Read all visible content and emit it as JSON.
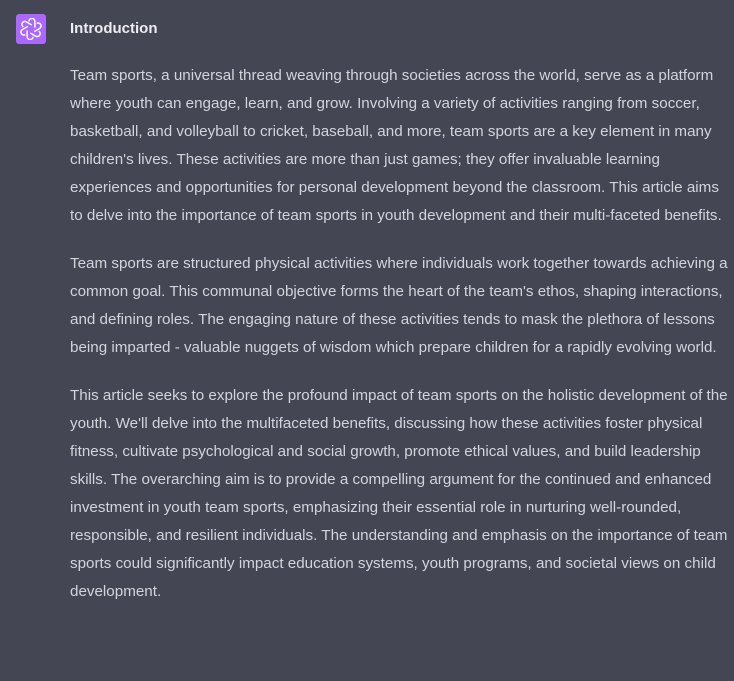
{
  "message": {
    "avatar_icon": "openai-logo-icon",
    "avatar_color": "#ab68ff",
    "heading": "Introduction",
    "paragraphs": [
      "Team sports, a universal thread weaving through societies across the world, serve as a platform where youth can engage, learn, and grow. Involving a variety of activities ranging from soccer, basketball, and volleyball to cricket, baseball, and more, team sports are a key element in many children's lives. These activities are more than just games; they offer invaluable learning experiences and opportunities for personal development beyond the classroom. This article aims to delve into the importance of team sports in youth development and their multi-faceted benefits.",
      "Team sports are structured physical activities where individuals work together towards achieving a common goal. This communal objective forms the heart of the team's ethos, shaping interactions, and defining roles. The engaging nature of these activities tends to mask the plethora of lessons being imparted - valuable nuggets of wisdom which prepare children for a rapidly evolving world.",
      "This article seeks to explore the profound impact of team sports on the holistic development of the youth. We'll delve into the multifaceted benefits, discussing how these activities foster physical fitness, cultivate psychological and social growth, promote ethical values, and build leadership skills. The overarching aim is to provide a compelling argument for the continued and enhanced investment in youth team sports, emphasizing their essential role in nurturing well-rounded, responsible, and resilient individuals. The understanding and emphasis on the importance of team sports could significantly impact education systems, youth programs, and societal views on child development."
    ]
  }
}
